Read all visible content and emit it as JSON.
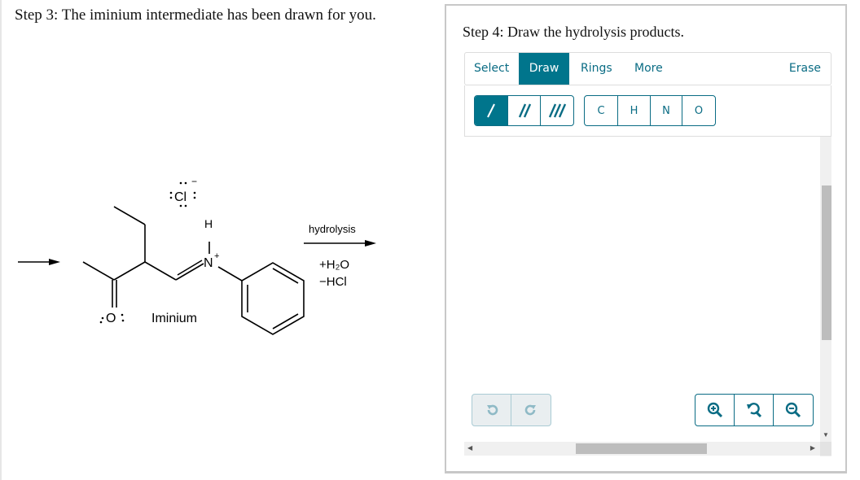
{
  "step3": {
    "title": "Step 3: The iminium intermediate has been drawn for you."
  },
  "scheme": {
    "intermediate_label": "Iminium",
    "counter_ion": "Cl",
    "counter_ion_charge": "−",
    "atoms": {
      "oxygen": "O",
      "nitrogen": "N",
      "nitrogen_charge": "+",
      "hydrogen": "H"
    },
    "reaction_label": "hydrolysis",
    "reagents": [
      "+H₂O",
      "−HCl"
    ]
  },
  "step4": {
    "title": "Step 4: Draw the hydrolysis products."
  },
  "editor": {
    "tabs": [
      {
        "label": "Select",
        "active": false
      },
      {
        "label": "Draw",
        "active": true
      },
      {
        "label": "Rings",
        "active": false
      },
      {
        "label": "More",
        "active": false
      }
    ],
    "erase_label": "Erase",
    "bond_tools": [
      {
        "name": "single-bond",
        "active": true
      },
      {
        "name": "double-bond",
        "active": false
      },
      {
        "name": "triple-bond",
        "active": false
      }
    ],
    "atom_tools": [
      "C",
      "H",
      "N",
      "O"
    ],
    "undo_icon": "undo-icon",
    "redo_icon": "redo-icon",
    "zoom_tools": [
      "zoom-in-icon",
      "reset-zoom-icon",
      "zoom-out-icon"
    ],
    "accent_color": "#00758c"
  }
}
